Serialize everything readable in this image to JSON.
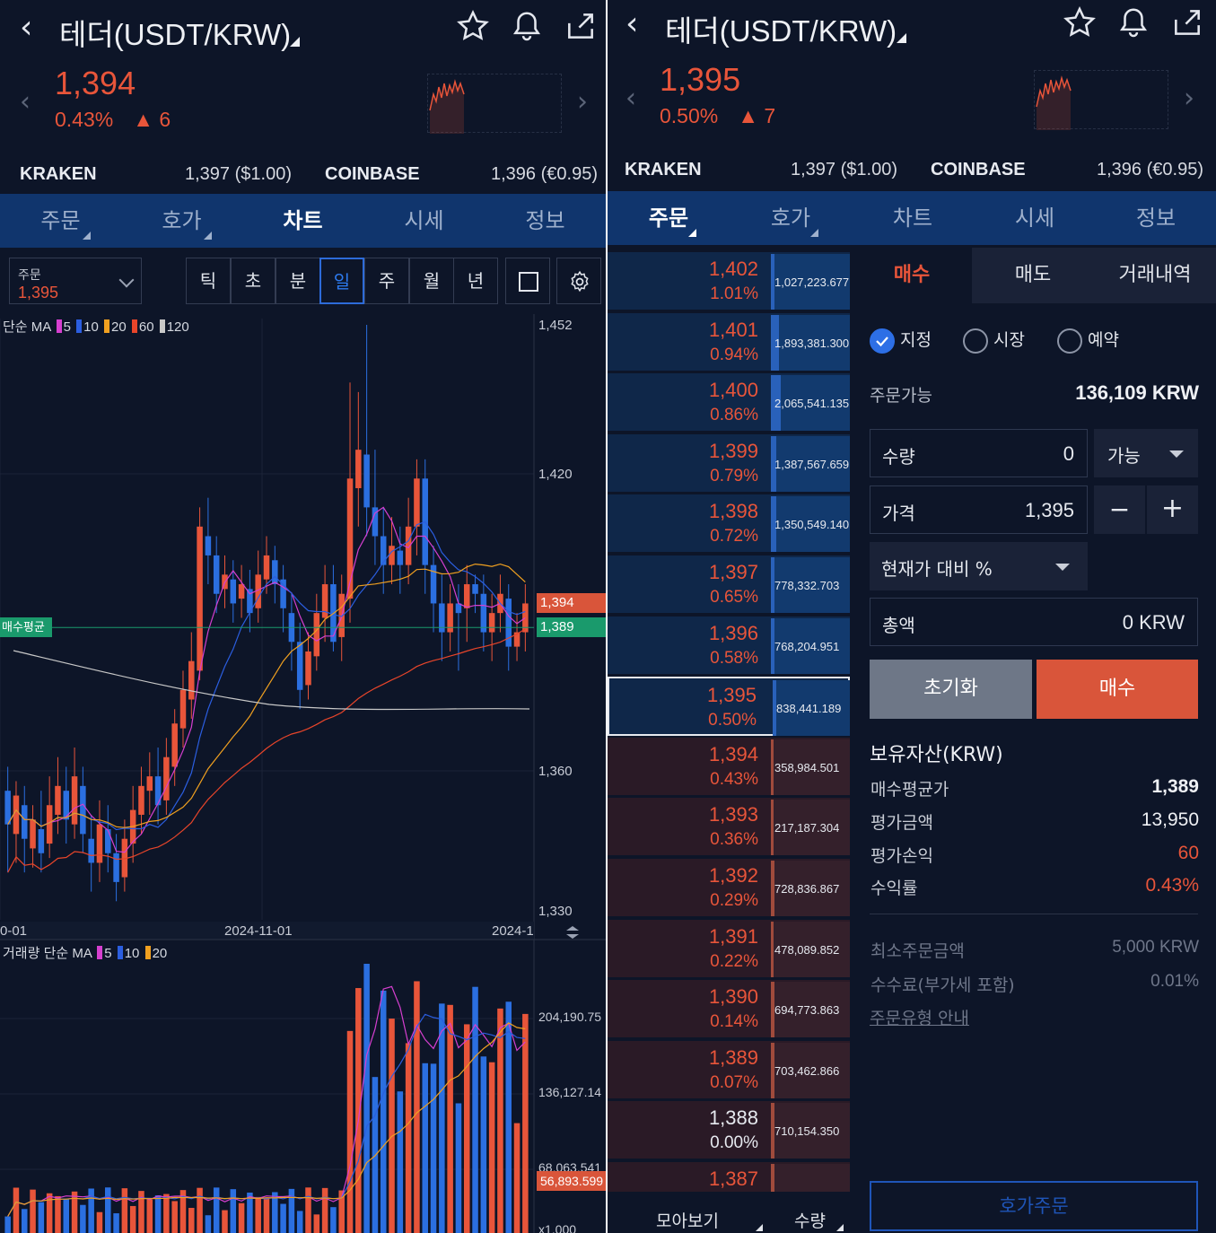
{
  "left": {
    "title": "테더(USDT/KRW)",
    "price": "1,394",
    "change_pct": "0.43%",
    "change_abs": "▲ 6",
    "exchanges": [
      {
        "name": "KRAKEN",
        "value": "1,397 ($1.00)"
      },
      {
        "name": "COINBASE",
        "value": "1,396 (€0.95)"
      }
    ],
    "tabs": [
      "주문",
      "호가",
      "차트",
      "시세",
      "정보"
    ],
    "active_tab": "차트",
    "order_select": {
      "label": "주문",
      "value": "1,395"
    },
    "timeframes": [
      "틱",
      "초",
      "분",
      "일",
      "주",
      "월",
      "년"
    ],
    "active_timeframe": "일",
    "ma_legend": {
      "prefix": "단순 MA",
      "periods": [
        "5",
        "10",
        "20",
        "60",
        "120"
      ]
    },
    "price_axis": [
      "1,452",
      "1,420",
      "1,360",
      "1,330"
    ],
    "current_tag": "1,394",
    "avg_tag": "1,389",
    "avg_label": "매수평균",
    "x_axis": [
      "0-01",
      "2024-11-01",
      "2024-1"
    ],
    "volume_legend": {
      "prefix": "거래량 단순 MA",
      "periods": [
        "5",
        "10",
        "20"
      ]
    },
    "volume_axis": [
      "204,190.75",
      "136,127.14",
      "68,063.541"
    ],
    "volume_tag": "56,893.599",
    "volume_bottom": "x1,000",
    "colors": {
      "up": "#e8553a",
      "down": "#2b6fe0",
      "bg": "#0d1528",
      "tab_bar": "#10356d",
      "avg": "#1a9a6c"
    }
  },
  "right": {
    "title": "테더(USDT/KRW)",
    "price": "1,395",
    "change_pct": "0.50%",
    "change_abs": "▲ 7",
    "exchanges": [
      {
        "name": "KRAKEN",
        "value": "1,397 ($1.00)"
      },
      {
        "name": "COINBASE",
        "value": "1,396 (€0.95)"
      }
    ],
    "tabs": [
      "주문",
      "호가",
      "차트",
      "시세",
      "정보"
    ],
    "active_tab": "주문",
    "orderbook": [
      {
        "price": "1,402",
        "pct": "1.01%",
        "vol": "1,027,223.677",
        "side": "ask",
        "fill": 0.05
      },
      {
        "price": "1,401",
        "pct": "0.94%",
        "vol": "1,893,381.300",
        "side": "ask",
        "fill": 0.1
      },
      {
        "price": "1,400",
        "pct": "0.86%",
        "vol": "2,065,541.135",
        "side": "ask",
        "fill": 0.12
      },
      {
        "price": "1,399",
        "pct": "0.79%",
        "vol": "1,387,567.659",
        "side": "ask",
        "fill": 0.07
      },
      {
        "price": "1,398",
        "pct": "0.72%",
        "vol": "1,350,549.140",
        "side": "ask",
        "fill": 0.07
      },
      {
        "price": "1,397",
        "pct": "0.65%",
        "vol": "778,332.703",
        "side": "ask",
        "fill": 0.04
      },
      {
        "price": "1,396",
        "pct": "0.58%",
        "vol": "768,204.951",
        "side": "ask",
        "fill": 0.04
      },
      {
        "price": "1,395",
        "pct": "0.50%",
        "vol": "838,441.189",
        "side": "ask",
        "fill": 0.04,
        "current": true
      },
      {
        "price": "1,394",
        "pct": "0.43%",
        "vol": "358,984.501",
        "side": "bid",
        "fill": 0.02
      },
      {
        "price": "1,393",
        "pct": "0.36%",
        "vol": "217,187.304",
        "side": "bid",
        "fill": 0.01
      },
      {
        "price": "1,392",
        "pct": "0.29%",
        "vol": "728,836.867",
        "side": "bid",
        "fill": 0.04
      },
      {
        "price": "1,391",
        "pct": "0.22%",
        "vol": "478,089.852",
        "side": "bid",
        "fill": 0.02
      },
      {
        "price": "1,390",
        "pct": "0.14%",
        "vol": "694,773.863",
        "side": "bid",
        "fill": 0.04
      },
      {
        "price": "1,389",
        "pct": "0.07%",
        "vol": "703,462.866",
        "side": "bid",
        "fill": 0.04
      },
      {
        "price": "1,388",
        "pct": "0.00%",
        "vol": "710,154.350",
        "side": "bid",
        "fill": 0.04,
        "neutral": true
      },
      {
        "price": "1,387",
        "pct": "",
        "vol": "",
        "side": "bid",
        "fill": 0.04
      }
    ],
    "order_tabs": [
      "매수",
      "매도",
      "거래내역"
    ],
    "order_types": [
      "지정",
      "시장",
      "예약"
    ],
    "available_label": "주문가능",
    "available_value": "136,109 KRW",
    "qty_label": "수량",
    "qty_value": "0",
    "qty_option": "가능",
    "price_label": "가격",
    "price_value": "1,395",
    "minus": "−",
    "plus": "+",
    "pct_select": "현재가 대비 %",
    "total_label": "총액",
    "total_value": "0 KRW",
    "reset_button": "초기화",
    "buy_button": "매수",
    "holdings_title": "보유자산(KRW)",
    "holdings": [
      {
        "k": "매수평균가",
        "v": "1,389"
      },
      {
        "k": "평가금액",
        "v": "13,950"
      },
      {
        "k": "평가손익",
        "v": "60"
      },
      {
        "k": "수익률",
        "v": "0.43%"
      }
    ],
    "info": [
      {
        "k": "최소주문금액",
        "v": "5,000 KRW"
      },
      {
        "k": "수수료(부가세 포함)",
        "v": "0.01%"
      }
    ],
    "info_link": "주문유형 안내",
    "bottom_left": "모아보기",
    "bottom_right": "수량",
    "quote_order_button": "호가주문"
  }
}
